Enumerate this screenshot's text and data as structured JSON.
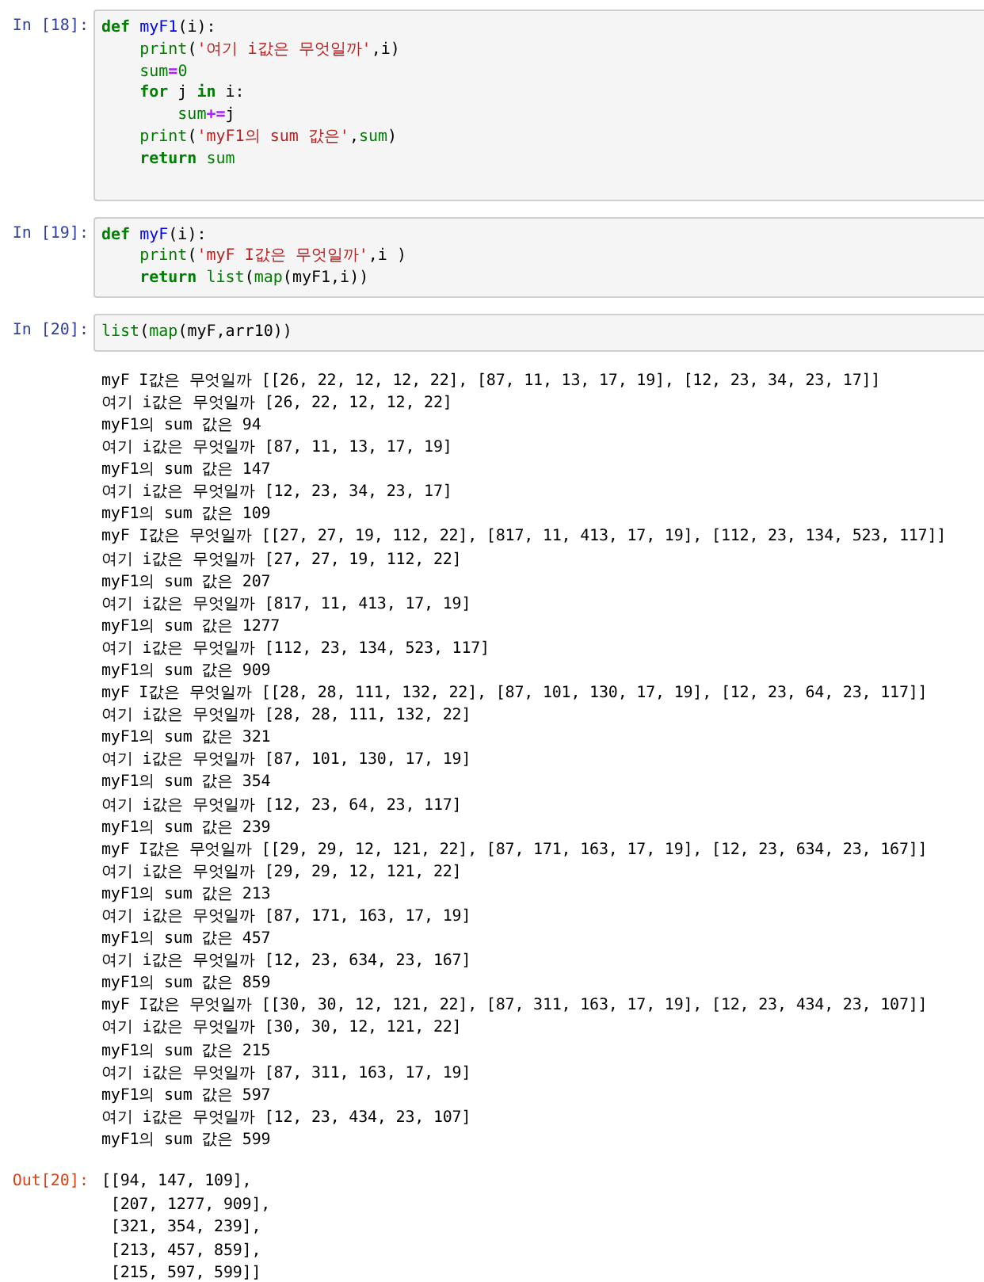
{
  "cells": [
    {
      "prompt": "In [18]:",
      "code": [
        [
          {
            "t": "def ",
            "kind": "keyword"
          },
          {
            "t": "myF1",
            "kind": "name"
          },
          {
            "t": "(i):",
            "kind": "plain"
          }
        ],
        [
          {
            "t": "    print",
            "kind": "builtin"
          },
          {
            "t": "(",
            "kind": "plain"
          },
          {
            "t": "'여기 i값은 무엇일까'",
            "kind": "string"
          },
          {
            "t": ",i)",
            "kind": "plain"
          }
        ],
        [
          {
            "t": "    sum",
            "kind": "builtin"
          },
          {
            "t": "=",
            "kind": "operator"
          },
          {
            "t": "0",
            "kind": "number"
          }
        ],
        [
          {
            "t": "    for",
            "kind": "keyword"
          },
          {
            "t": " j ",
            "kind": "plain"
          },
          {
            "t": "in",
            "kind": "keyword"
          },
          {
            "t": " i:",
            "kind": "plain"
          }
        ],
        [
          {
            "t": "        sum",
            "kind": "builtin"
          },
          {
            "t": "+=",
            "kind": "operator"
          },
          {
            "t": "j",
            "kind": "plain"
          }
        ],
        [
          {
            "t": "    print",
            "kind": "builtin"
          },
          {
            "t": "(",
            "kind": "plain"
          },
          {
            "t": "'myF1의 sum 값은'",
            "kind": "string"
          },
          {
            "t": ",",
            "kind": "plain"
          },
          {
            "t": "sum",
            "kind": "builtin"
          },
          {
            "t": ")",
            "kind": "plain"
          }
        ],
        [
          {
            "t": "    return ",
            "kind": "keyword"
          },
          {
            "t": "sum",
            "kind": "builtin"
          }
        ]
      ]
    },
    {
      "prompt": "In [19]:",
      "code": [
        [
          {
            "t": "def ",
            "kind": "keyword"
          },
          {
            "t": "myF",
            "kind": "name"
          },
          {
            "t": "(i):",
            "kind": "plain"
          }
        ],
        [
          {
            "t": "    print",
            "kind": "builtin"
          },
          {
            "t": "(",
            "kind": "plain"
          },
          {
            "t": "'myF I값은 무엇일까'",
            "kind": "string"
          },
          {
            "t": ",i )",
            "kind": "plain"
          }
        ],
        [
          {
            "t": "    return ",
            "kind": "keyword"
          },
          {
            "t": "list",
            "kind": "builtin"
          },
          {
            "t": "(",
            "kind": "plain"
          },
          {
            "t": "map",
            "kind": "builtin"
          },
          {
            "t": "(myF1,i))",
            "kind": "plain"
          }
        ]
      ]
    },
    {
      "prompt": "In [20]:",
      "code": [
        [
          {
            "t": "list",
            "kind": "builtin"
          },
          {
            "t": "(",
            "kind": "plain"
          },
          {
            "t": "map",
            "kind": "builtin"
          },
          {
            "t": "(myF,arr10))",
            "kind": "plain"
          }
        ]
      ],
      "stream": [
        "myF I값은 무엇일까 [[26, 22, 12, 12, 22], [87, 11, 13, 17, 19], [12, 23, 34, 23, 17]]",
        "여기 i값은 무엇일까 [26, 22, 12, 12, 22]",
        "myF1의 sum 값은 94",
        "여기 i값은 무엇일까 [87, 11, 13, 17, 19]",
        "myF1의 sum 값은 147",
        "여기 i값은 무엇일까 [12, 23, 34, 23, 17]",
        "myF1의 sum 값은 109",
        "myF I값은 무엇일까 [[27, 27, 19, 112, 22], [817, 11, 413, 17, 19], [112, 23, 134, 523, 117]]",
        "여기 i값은 무엇일까 [27, 27, 19, 112, 22]",
        "myF1의 sum 값은 207",
        "여기 i값은 무엇일까 [817, 11, 413, 17, 19]",
        "myF1의 sum 값은 1277",
        "여기 i값은 무엇일까 [112, 23, 134, 523, 117]",
        "myF1의 sum 값은 909",
        "myF I값은 무엇일까 [[28, 28, 111, 132, 22], [87, 101, 130, 17, 19], [12, 23, 64, 23, 117]]",
        "여기 i값은 무엇일까 [28, 28, 111, 132, 22]",
        "myF1의 sum 값은 321",
        "여기 i값은 무엇일까 [87, 101, 130, 17, 19]",
        "myF1의 sum 값은 354",
        "여기 i값은 무엇일까 [12, 23, 64, 23, 117]",
        "myF1의 sum 값은 239",
        "myF I값은 무엇일까 [[29, 29, 12, 121, 22], [87, 171, 163, 17, 19], [12, 23, 634, 23, 167]]",
        "여기 i값은 무엇일까 [29, 29, 12, 121, 22]",
        "myF1의 sum 값은 213",
        "여기 i값은 무엇일까 [87, 171, 163, 17, 19]",
        "myF1의 sum 값은 457",
        "여기 i값은 무엇일까 [12, 23, 634, 23, 167]",
        "myF1의 sum 값은 859",
        "myF I값은 무엇일까 [[30, 30, 12, 121, 22], [87, 311, 163, 17, 19], [12, 23, 434, 23, 107]]",
        "여기 i값은 무엇일까 [30, 30, 12, 121, 22]",
        "myF1의 sum 값은 215",
        "여기 i값은 무엇일까 [87, 311, 163, 17, 19]",
        "myF1의 sum 값은 597",
        "여기 i값은 무엇일까 [12, 23, 434, 23, 107]",
        "myF1의 sum 값은 599"
      ],
      "result": {
        "prompt": "Out[20]:",
        "lines": [
          "[[94, 147, 109],",
          " [207, 1277, 909],",
          " [321, 354, 239],",
          " [213, 457, 859],",
          " [215, 597, 599]]"
        ]
      }
    }
  ]
}
